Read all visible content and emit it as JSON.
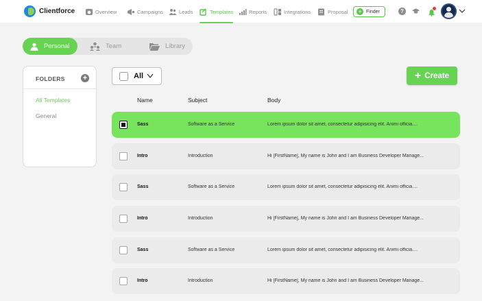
{
  "app": {
    "name": "Clientforce"
  },
  "nav": [
    {
      "label": "Overview",
      "icon": "dashboard-icon"
    },
    {
      "label": "Campaigns",
      "icon": "megaphone-icon"
    },
    {
      "label": "Leads",
      "icon": "users-icon"
    },
    {
      "label": "Templates",
      "icon": "template-icon",
      "active": true
    },
    {
      "label": "Reports",
      "icon": "bar-chart-icon"
    },
    {
      "label": "Integrations",
      "icon": "integrations-icon"
    },
    {
      "label": "Proposal",
      "icon": "document-icon"
    }
  ],
  "finder": {
    "label": "Finder"
  },
  "tabs": [
    {
      "label": "Personal",
      "active": true
    },
    {
      "label": "Team"
    },
    {
      "label": "Library"
    }
  ],
  "folders": {
    "title": "FOLDERS",
    "items": [
      {
        "label": "All Templates",
        "active": true
      },
      {
        "label": "General"
      }
    ]
  },
  "select_all": {
    "label": "All"
  },
  "create": {
    "label": "Create"
  },
  "table": {
    "columns": [
      "Name",
      "Subject",
      "Body"
    ],
    "rows": [
      {
        "name": "Sass",
        "subject": "Software as a Service",
        "body": "Lorem ipsum dolor sit amet, consectetur adipisicing elit. Animi officia....",
        "selected": true
      },
      {
        "name": "Intro",
        "subject": "Introduction",
        "body": "Hi [FirstName], My name is John and I am Business Developer Manage..."
      },
      {
        "name": "Sass",
        "subject": "Software as a Service",
        "body": "Lorem ipsum dolor sit amet, consectetur adipisicing elit. Animi officia...."
      },
      {
        "name": "Intro",
        "subject": "Introduction",
        "body": "Hi [FirstName], My name is John and I am Business Developer Manage..."
      },
      {
        "name": "Sass",
        "subject": "Software as a Service",
        "body": "Lorem ipsum dolor sit amet, consectetur adipisicing elit. Animi officia...."
      },
      {
        "name": "Intro",
        "subject": "Introduction",
        "body": "Hi [FirstName], My name is John and I am Business Developer Manage..."
      }
    ]
  },
  "colors": {
    "accent": "#66d352",
    "accent_text": "#5ac64b",
    "selected_row": "#78e35d"
  }
}
